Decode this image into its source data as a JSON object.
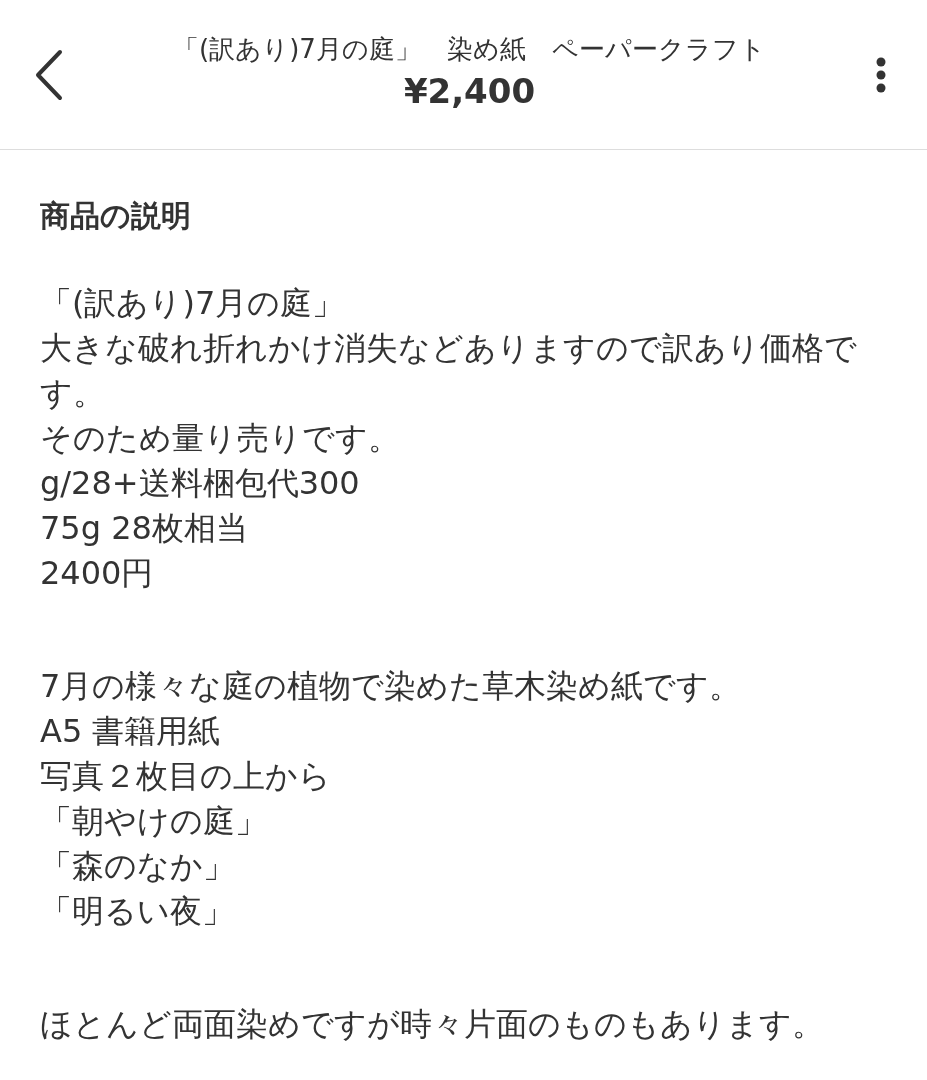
{
  "header": {
    "title": "「(訳あり)7月の庭」　染め紙　ペーパークラフト",
    "price": "¥2,400"
  },
  "section": {
    "heading": "商品の説明",
    "paragraphs": [
      [
        "「(訳あり)7月の庭」",
        "大きな破れ折れかけ消失などありますので訳あり価格です。",
        "そのため量り売りです。",
        "g/28+送料梱包代300",
        "75g 28枚相当",
        "2400円"
      ],
      [
        "7月の様々な庭の植物で染めた草木染め紙です。",
        "A5 書籍用紙",
        "写真２枚目の上から",
        "「朝やけの庭」",
        "「森のなか」",
        "「明るい夜」"
      ],
      [
        "ほとんど両面染めですが時々片面のものもあります。"
      ]
    ]
  }
}
